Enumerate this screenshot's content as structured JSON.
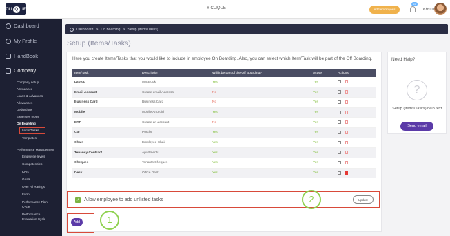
{
  "app": {
    "logo_text_left": "CLI",
    "logo_text_q": "Q",
    "logo_text_right": "UE",
    "window_title": "Y CLIQUE",
    "add_employee": "Add employees",
    "notification_count": "22",
    "user_name": "Ayman"
  },
  "sidebar": {
    "main": [
      {
        "label": "Dashboard"
      },
      {
        "label": "My Profile"
      },
      {
        "label": "HandBook"
      },
      {
        "label": "Company"
      }
    ],
    "company_items": [
      "Company setup",
      "Attendance",
      "Loans & Advances",
      "Allowances",
      "Deductions",
      "Expenses types",
      "On Boarding"
    ],
    "onboarding_items": [
      "Items/Tasks",
      "Templates"
    ],
    "perf_title": "Performance Management",
    "perf_items": [
      "Employee levels",
      "Competencies",
      "KPIs",
      "Goals",
      "Over All Ratings",
      "Form",
      "Performance Plan",
      "Cycle",
      "Performance",
      "Evaluation Cycle"
    ]
  },
  "breadcrumb": {
    "home": "Dashboard",
    "sep1": ">",
    "level1": "On Boarding",
    "sep2": ">",
    "current": "Setup (Items/Tasks)"
  },
  "page": {
    "title": "Setup (Items/Tasks)",
    "intro": "Here you create Items/Tasks that you would like to include in employee On Boarding. Also, you can select which Item/Task will be part of the Off Boarding."
  },
  "table": {
    "headers": [
      "Item/Task",
      "Description",
      "Will it be part of the Off Boarding?",
      "Active",
      "Actions"
    ],
    "rows": [
      {
        "name": "Laptop",
        "desc": "MacBook",
        "off": "Yes",
        "active": "Yes"
      },
      {
        "name": "Email Account",
        "desc": "Create email Address",
        "off": "No",
        "active": "Yes"
      },
      {
        "name": "Business Card",
        "desc": "Business Card",
        "off": "No",
        "active": "Yes"
      },
      {
        "name": "Mobile",
        "desc": "Mobile Android",
        "off": "Yes",
        "active": "Yes"
      },
      {
        "name": "ERP",
        "desc": "Create an account",
        "off": "No",
        "active": "Yes"
      },
      {
        "name": "Car",
        "desc": "Porche",
        "off": "Yes",
        "active": "Yes"
      },
      {
        "name": "Chair",
        "desc": "Employee Chair",
        "off": "Yes",
        "active": "Yes"
      },
      {
        "name": "Tenancy Contract",
        "desc": "Apartments",
        "off": "Yes",
        "active": "Yes"
      },
      {
        "name": "Cheques",
        "desc": "Tenants Cheques",
        "off": "Yes",
        "active": "Yes"
      },
      {
        "name": "Desk",
        "desc": "Office Desk",
        "off": "Yes",
        "active": "Yes"
      }
    ]
  },
  "allow": {
    "label": "Allow employee to add unlisted tasks",
    "checked": true,
    "update_label": "Update",
    "marker": "2"
  },
  "add": {
    "label": "Add",
    "marker": "1"
  },
  "help": {
    "title": "Need Help?",
    "icon": "?",
    "text": "Setup (Items/Tasks) help text.",
    "button": "Send email"
  },
  "colors": {
    "sidebar_bg": "#1d2033",
    "accent_purple": "#5b3aa8",
    "yes_green": "#8bc34a",
    "no_red": "#e25b4a",
    "highlight_red": "#d84a3a",
    "marker_green": "#8fd14f"
  }
}
